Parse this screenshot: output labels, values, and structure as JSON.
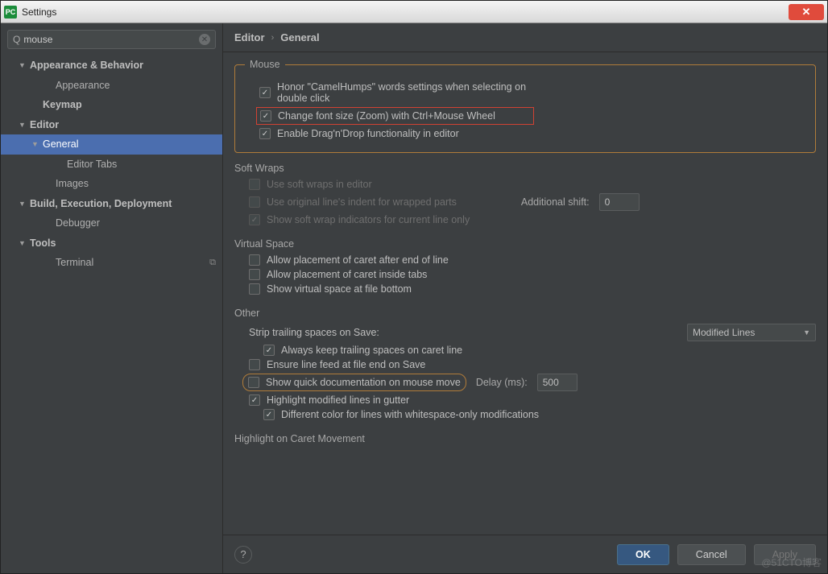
{
  "title": "Settings",
  "search": {
    "value": "mouse"
  },
  "sidebar": [
    {
      "label": "Appearance & Behavior",
      "bold": true,
      "indent": 22,
      "arrow": "▼"
    },
    {
      "label": "Appearance",
      "bold": false,
      "indent": 54,
      "arrow": ""
    },
    {
      "label": "Keymap",
      "bold": true,
      "indent": 38,
      "arrow": ""
    },
    {
      "label": "Editor",
      "bold": true,
      "indent": 22,
      "arrow": "▼"
    },
    {
      "label": "General",
      "bold": false,
      "indent": 38,
      "arrow": "▼",
      "selected": true
    },
    {
      "label": "Editor Tabs",
      "bold": false,
      "indent": 68,
      "arrow": ""
    },
    {
      "label": "Images",
      "bold": false,
      "indent": 54,
      "arrow": ""
    },
    {
      "label": "Build, Execution, Deployment",
      "bold": true,
      "indent": 22,
      "arrow": "▼"
    },
    {
      "label": "Debugger",
      "bold": false,
      "indent": 54,
      "arrow": ""
    },
    {
      "label": "Tools",
      "bold": true,
      "indent": 22,
      "arrow": "▼"
    },
    {
      "label": "Terminal",
      "bold": false,
      "indent": 54,
      "arrow": "",
      "trailingIcon": true
    }
  ],
  "breadcrumb": {
    "root": "Editor",
    "leaf": "General"
  },
  "mouse": {
    "legend": "Mouse",
    "honor": "Honor \"CamelHumps\" words settings when selecting on double click",
    "zoom": "Change font size (Zoom) with Ctrl+Mouse Wheel",
    "dnd": "Enable Drag'n'Drop functionality in editor"
  },
  "softwraps": {
    "legend": "Soft Wraps",
    "use": "Use soft wraps in editor",
    "indent": "Use original line's indent for wrapped parts",
    "shiftLabel": "Additional shift:",
    "shiftValue": "0",
    "indicators": "Show soft wrap indicators for current line only"
  },
  "virtual": {
    "legend": "Virtual Space",
    "caretEnd": "Allow placement of caret after end of line",
    "caretTabs": "Allow placement of caret inside tabs",
    "bottom": "Show virtual space at file bottom"
  },
  "other": {
    "legend": "Other",
    "stripLabel": "Strip trailing spaces on Save:",
    "stripValue": "Modified Lines",
    "keepCaret": "Always keep trailing spaces on caret line",
    "lineFeed": "Ensure line feed at file end on Save",
    "quickDoc": "Show quick documentation on mouse move",
    "delayLabel": "Delay (ms):",
    "delayValue": "500",
    "highlightMod": "Highlight modified lines in gutter",
    "diffColor": "Different color for lines with whitespace-only modifications"
  },
  "caretMove": {
    "legend": "Highlight on Caret Movement"
  },
  "footer": {
    "ok": "OK",
    "cancel": "Cancel",
    "apply": "Apply"
  },
  "watermark": "@51CTO博客"
}
